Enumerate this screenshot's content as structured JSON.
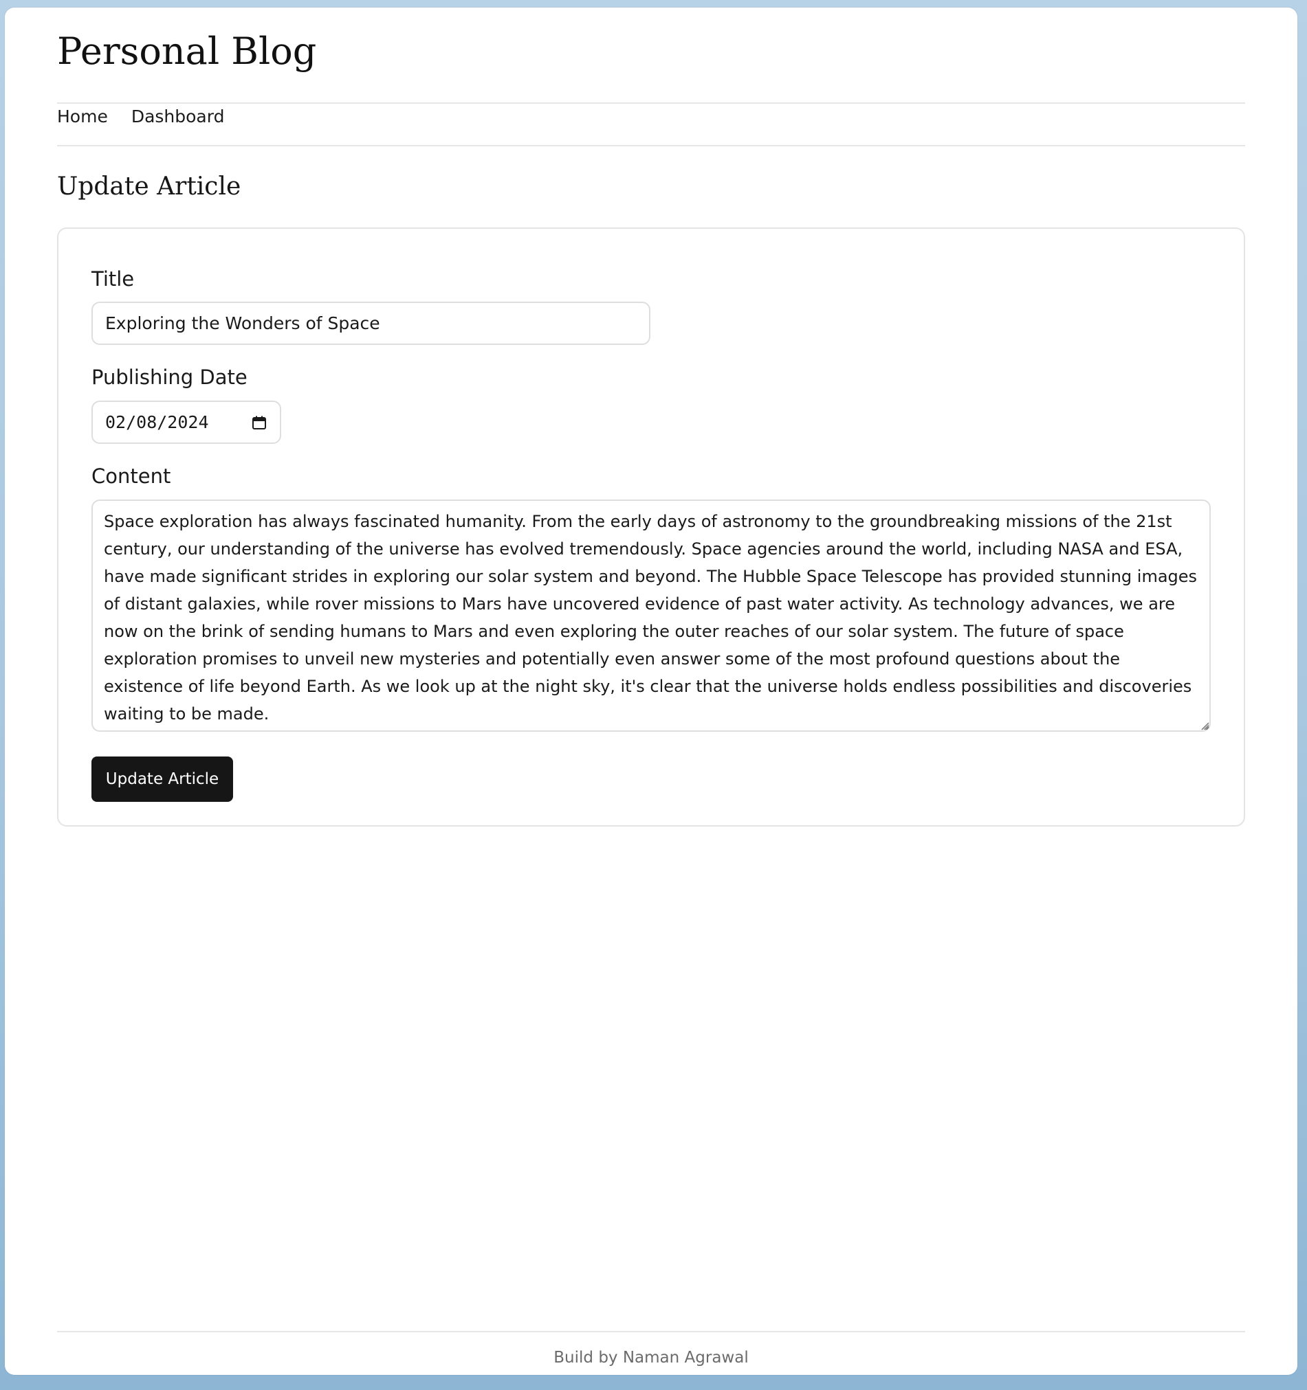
{
  "site": {
    "title": "Personal Blog"
  },
  "nav": {
    "items": [
      {
        "label": "Home"
      },
      {
        "label": "Dashboard"
      }
    ]
  },
  "page": {
    "heading": "Update Article"
  },
  "form": {
    "title_label": "Title",
    "title_value": "Exploring the Wonders of Space",
    "date_label": "Publishing Date",
    "date_value": "02/08/2024",
    "content_label": "Content",
    "content_value": "Space exploration has always fascinated humanity. From the early days of astronomy to the groundbreaking missions of the 21st century, our understanding of the universe has evolved tremendously. Space agencies around the world, including NASA and ESA, have made significant strides in exploring our solar system and beyond. The Hubble Space Telescope has provided stunning images of distant galaxies, while rover missions to Mars have uncovered evidence of past water activity. As technology advances, we are now on the brink of sending humans to Mars and even exploring the outer reaches of our solar system. The future of space exploration promises to unveil new mysteries and potentially even answer some of the most profound questions about the existence of life beyond Earth. As we look up at the night sky, it's clear that the universe holds endless possibilities and discoveries waiting to be made.",
    "submit_label": "Update Article"
  },
  "footer": {
    "text": "Build by Naman Agrawal"
  },
  "colors": {
    "background": "#a9c8e0",
    "button": "#161616",
    "border": "#dedede"
  },
  "icons": {
    "date_picker": "calendar-icon",
    "textarea_resize": "resize-grip-icon"
  }
}
